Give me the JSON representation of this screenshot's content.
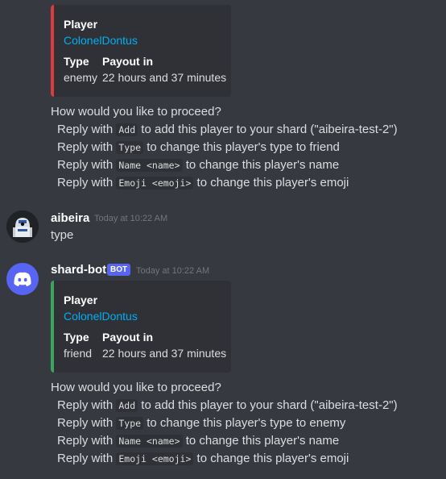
{
  "embed1": {
    "accent": "#d83c3e",
    "title": "Player",
    "player_link": "ColonelDontus",
    "type_label": "Type",
    "type_value": "enemy",
    "payout_label": "Payout in",
    "payout_value": "22 hours and 37 minutes"
  },
  "prompt1": {
    "question": "How would you like to proceed?",
    "lines": [
      {
        "pre": "Reply with ",
        "code": "Add",
        "post": " to add this player to your shard (\"aibeira-test-2\")"
      },
      {
        "pre": "Reply with ",
        "code": "Type",
        "post": " to change this player's type to friend"
      },
      {
        "pre": "Reply with ",
        "code": "Name <name>",
        "post": " to change this player's name"
      },
      {
        "pre": "Reply with ",
        "code": "Emoji <emoji>",
        "post": " to change this player's emoji"
      }
    ]
  },
  "message_user": {
    "username": "aibeira",
    "timestamp": "Today at 10:22 AM",
    "content": "type"
  },
  "message_bot": {
    "username": "shard-bot",
    "bot_tag": "BOT",
    "timestamp": "Today at 10:22 AM",
    "avatar_color": "#5865f2"
  },
  "embed2": {
    "accent": "#3ba55d",
    "title": "Player",
    "player_link": "ColonelDontus",
    "type_label": "Type",
    "type_value": "friend",
    "payout_label": "Payout in",
    "payout_value": "22 hours and 37 minutes"
  },
  "prompt2": {
    "question": "How would you like to proceed?",
    "lines": [
      {
        "pre": "Reply with ",
        "code": "Add",
        "post": " to add this player to your shard (\"aibeira-test-2\")"
      },
      {
        "pre": "Reply with ",
        "code": "Type",
        "post": " to change this player's type to enemy"
      },
      {
        "pre": "Reply with ",
        "code": "Name <name>",
        "post": " to change this player's name"
      },
      {
        "pre": "Reply with ",
        "code": "Emoji <emoji>",
        "post": " to change this player's emoji"
      }
    ]
  }
}
